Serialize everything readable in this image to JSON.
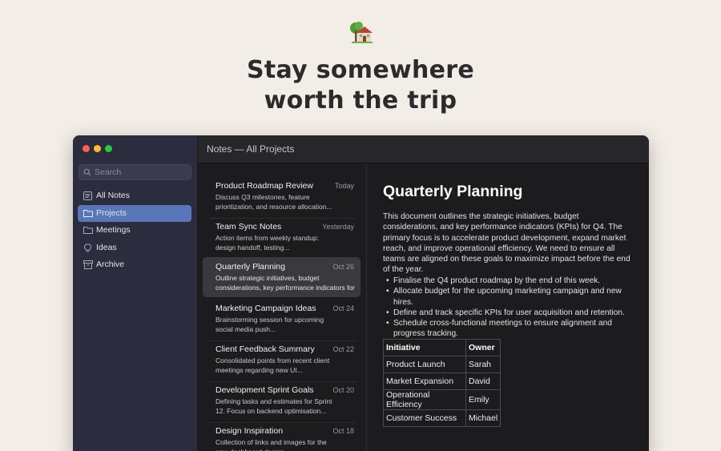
{
  "hero": {
    "icon": "house-with-tree-icon",
    "headline_line1": "Stay somewhere",
    "headline_line2": "worth the trip"
  },
  "window": {
    "title": "Notes — All Projects",
    "traffic_colors": [
      "#ff5f57",
      "#febc2e",
      "#28c840"
    ]
  },
  "sidebar": {
    "search_placeholder": "Search",
    "items": [
      {
        "label": "All Notes",
        "icon": "notes-icon",
        "active": false
      },
      {
        "label": "Projects",
        "icon": "folder-icon",
        "active": true
      },
      {
        "label": "Meetings",
        "icon": "folder-icon",
        "active": false
      },
      {
        "label": "Ideas",
        "icon": "lightbulb-icon",
        "active": false
      },
      {
        "label": "Archive",
        "icon": "archive-icon",
        "active": false
      }
    ],
    "accent": "#5977b8"
  },
  "notes": [
    {
      "title": "Product Roadmap Review",
      "date": "Today",
      "excerpt": "Discuss Q3 milestones, feature prioritization, and resource allocation..."
    },
    {
      "title": "Team Sync Notes",
      "date": "Yesterday",
      "excerpt": "Action items from weekly standup: design handoff, testing..."
    },
    {
      "title": "Quarterly Planning",
      "date": "Oct 26",
      "excerpt": "Outline strategic initiatives, budget considerations, key performance indicators for",
      "active": true
    },
    {
      "title": "Marketing Campaign Ideas",
      "date": "Oct 24",
      "excerpt": "Brainstorming session for upcoming social media push..."
    },
    {
      "title": "Client Feedback Summary",
      "date": "Oct 22",
      "excerpt": "Consolidated points from recent client meetings regarding new UI..."
    },
    {
      "title": "Development Sprint Goals",
      "date": "Oct 20",
      "excerpt": "Defining tasks and estimates for Sprint 12. Focus on backend optimisation..."
    },
    {
      "title": "Design Inspiration",
      "date": "Oct 18",
      "excerpt": "Collection of links and images for the new dashboard design..."
    }
  ],
  "document": {
    "title": "Quarterly Planning",
    "body": "This document outlines the strategic initiatives, budget considerations, and key performance indicators (KPIs) for Q4. The primary focus is to accelerate product development, expand market reach, and improve operational efficiency. We need to ensure all teams are aligned on these goals to maximize impact before the end of the year.",
    "bullets": [
      "Finalise the Q4 product roadmap by the end of this week.",
      "Allocate budget for the upcoming marketing campaign and new hires.",
      "Define and track specific KPIs for user acquisition and retention.",
      "Schedule cross-functional meetings to ensure alignment and progress tracking."
    ],
    "table": {
      "headers": [
        "Initiative",
        "Owner"
      ],
      "rows": [
        [
          "Product Launch",
          "Sarah"
        ],
        [
          "Market Expansion",
          "David"
        ],
        [
          "Operational Efficiency",
          "Emily"
        ],
        [
          "Customer Success",
          "Michael"
        ]
      ]
    }
  }
}
